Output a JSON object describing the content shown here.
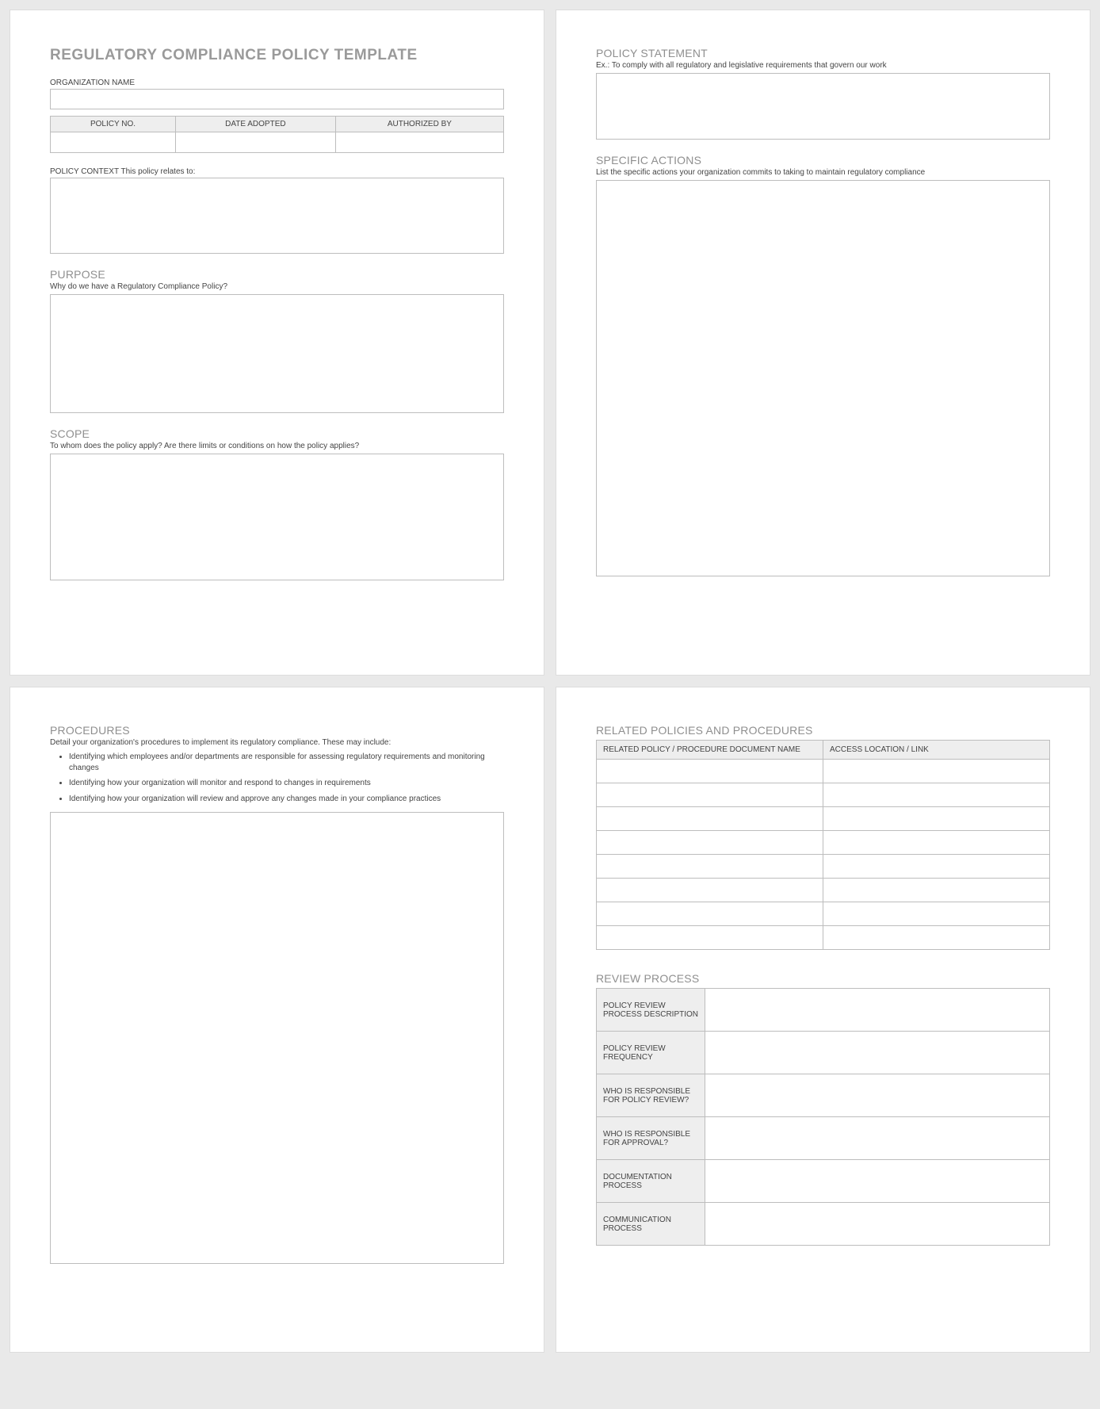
{
  "doc_title": "REGULATORY COMPLIANCE POLICY TEMPLATE",
  "page1": {
    "org_label": "ORGANIZATION NAME",
    "meta_headers": [
      "POLICY NO.",
      "DATE ADOPTED",
      "AUTHORIZED BY"
    ],
    "context_label": "POLICY CONTEXT  This policy relates to:",
    "purpose_title": "PURPOSE",
    "purpose_sub": "Why do we have a Regulatory Compliance Policy?",
    "scope_title": "SCOPE",
    "scope_sub": "To whom does the policy apply? Are there limits or conditions on how the policy applies?"
  },
  "page2": {
    "policy_statement_title": "POLICY STATEMENT",
    "policy_statement_sub": "Ex.: To comply with all regulatory and legislative requirements that govern our work",
    "specific_actions_title": "SPECIFIC ACTIONS",
    "specific_actions_sub": "List the specific actions your organization commits to taking to maintain regulatory compliance"
  },
  "page3": {
    "procedures_title": "PROCEDURES",
    "procedures_sub": "Detail your organization's procedures to implement its regulatory compliance. These may include:",
    "bullets": [
      "Identifying which employees and/or departments are responsible for assessing regulatory requirements and monitoring changes",
      "Identifying how your organization will monitor and respond to changes in requirements",
      "Identifying how your organization will review and approve any changes made in your compliance practices"
    ]
  },
  "page4": {
    "related_title": "RELATED POLICIES AND PROCEDURES",
    "related_headers": [
      "RELATED POLICY / PROCEDURE DOCUMENT NAME",
      "ACCESS LOCATION / LINK"
    ],
    "related_row_count": 8,
    "review_title": "REVIEW PROCESS",
    "review_rows": [
      "POLICY REVIEW PROCESS DESCRIPTION",
      "POLICY REVIEW FREQUENCY",
      "WHO IS RESPONSIBLE FOR POLICY REVIEW?",
      "WHO IS RESPONSIBLE FOR APPROVAL?",
      "DOCUMENTATION PROCESS",
      "COMMUNICATION PROCESS"
    ]
  }
}
